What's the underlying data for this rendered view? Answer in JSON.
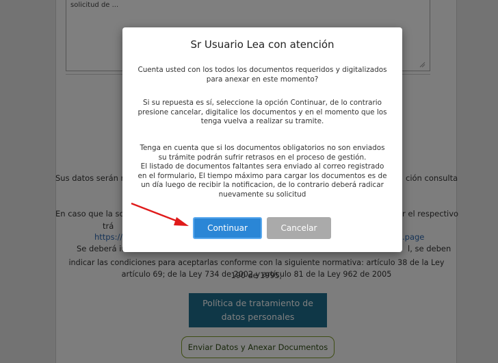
{
  "form": {
    "textarea_value": "solicitud de ...",
    "data_notice_left": "Sus datos serán r",
    "data_notice_right": "ción consulta",
    "case_line_left": "En caso que la so",
    "case_line_right": "r el respectivo",
    "case_line2_left": "trá",
    "link_left": "https://",
    "link_right": ".page",
    "legal_line1_left": "Se deberá indic",
    "legal_line1_right": "l, se deben",
    "legal_line2": "indicar las condiciones para aceptarlas conforme con la siguiente normativa: artículo 38 de la Ley 190 de 1995;",
    "legal_line3": "artículo 69; de la Ley 734 de 2002 y artículo 81 de la Ley 962 de 2005",
    "policy_button_line1": "Política de tratamiento de",
    "policy_button_line2": "datos personales",
    "send_button": "Enviar Datos y Anexar Documentos"
  },
  "modal": {
    "title": "Sr Usuario Lea con atención",
    "question": "Cuenta usted con los todos los documentos requeridos y digitalizados para anexar en este momento?",
    "instruction": "Si su repuesta es sí, seleccione la opción Continuar, de lo contrario presione cancelar, digitalice los documentos y en el momento que los tenga vuelva a realizar su tramite.",
    "warning_1": "Tenga en cuenta que si los documentos obligatorios no son enviados su trámite podrán sufrir retrasos en el proceso de gestión.",
    "warning_2": "El listado de documentos faltantes sera enviado al correo registrado en el formulario, El tiempo máximo para cargar los documentos es de un día luego de recibir la notificacion, de lo contrario deberá radicar nuevamente su solicitud",
    "continue_label": "Continuar",
    "cancel_label": "Cancelar"
  },
  "colors": {
    "primary_button": "#2a86d6",
    "cancel_button": "#aaaaaa",
    "policy_button": "#1e6e8e",
    "send_button_border": "#7d9a26",
    "annotation_arrow": "#e01b1b"
  },
  "icons": {
    "annotation": "red-arrow-icon",
    "resize": "resize-grip-icon"
  }
}
